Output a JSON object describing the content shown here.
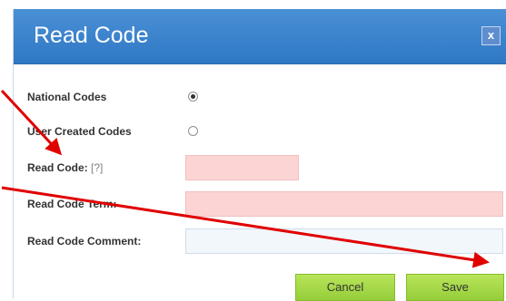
{
  "dialog": {
    "title": "Read Code",
    "close_label": "x"
  },
  "form": {
    "national_codes_label": "National Codes",
    "user_created_codes_label": "User Created Codes",
    "selected_code_type": "National Codes",
    "read_code_label": "Read Code:",
    "read_code_help": "[?]",
    "read_code_value": "",
    "read_code_term_label": "Read Code Term:",
    "read_code_term_value": "",
    "read_code_comment_label": "Read Code Comment:",
    "read_code_comment_value": ""
  },
  "buttons": {
    "cancel_label": "Cancel",
    "save_label": "Save"
  },
  "colors": {
    "titlebar": "#3a84cf",
    "required_field": "#fdd4d4",
    "optional_field": "#f2f7fc",
    "button_green": "#a6d94a",
    "annotation_arrow": "#e00000"
  }
}
